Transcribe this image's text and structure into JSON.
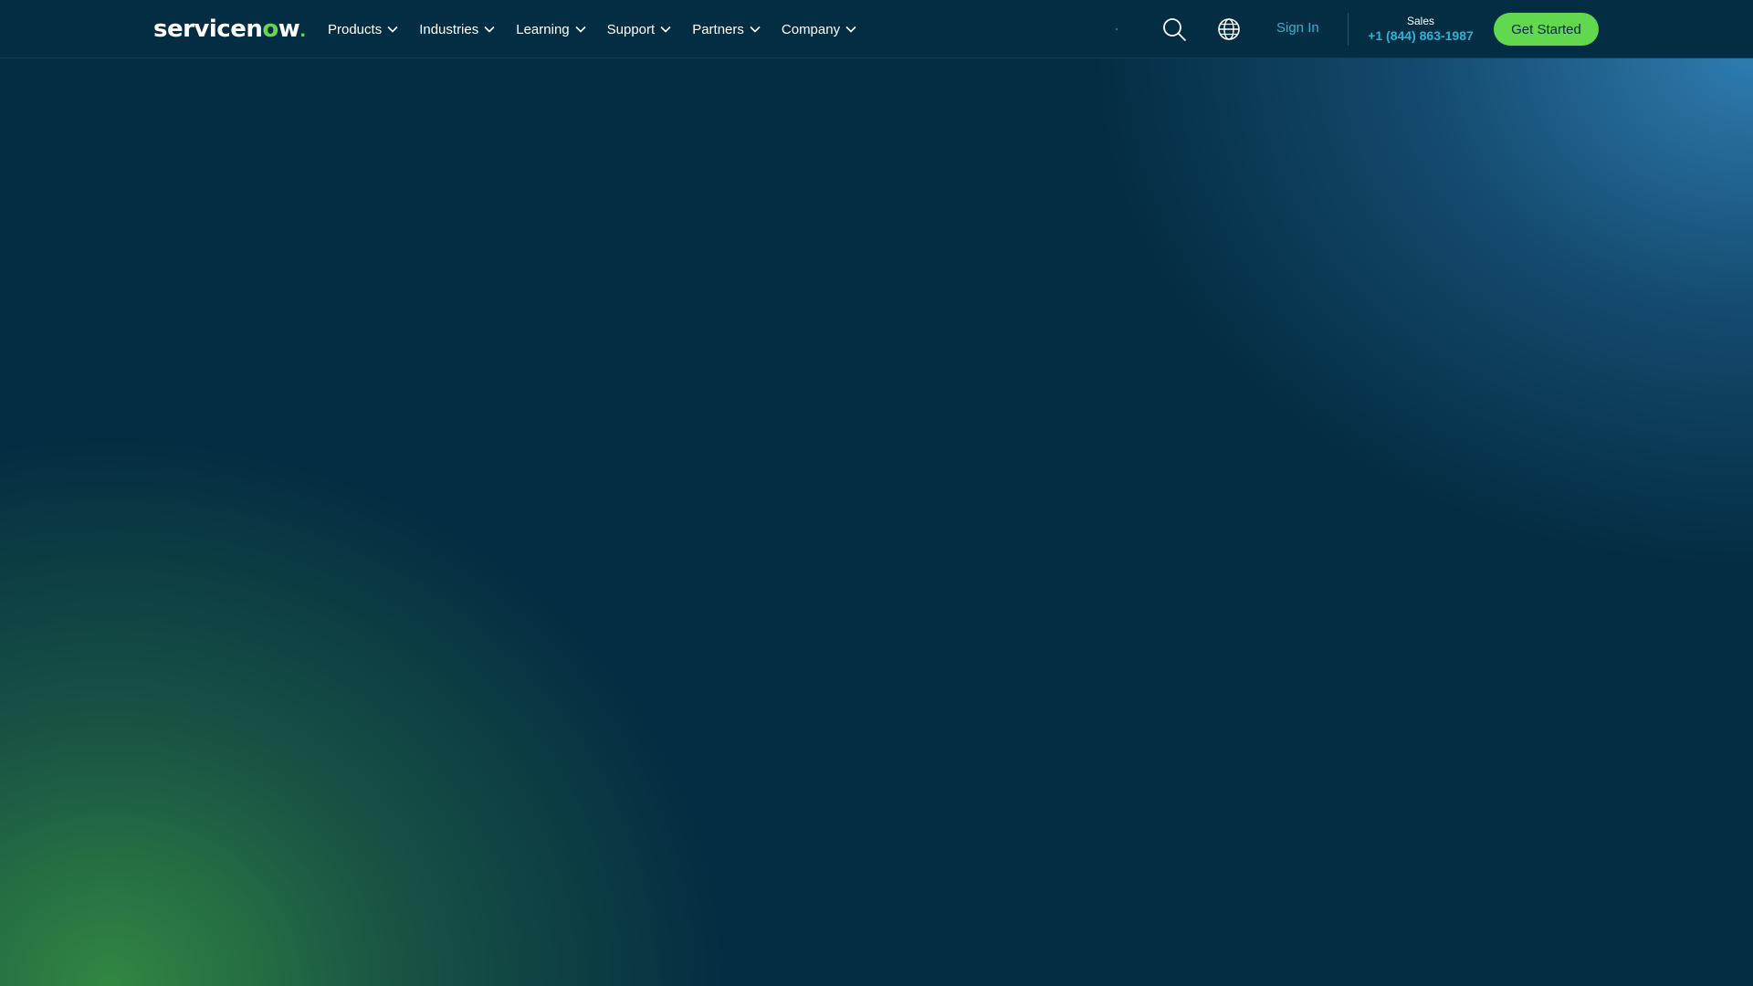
{
  "brand": {
    "logo_text_prefix": "servicen",
    "logo_text_o": "o",
    "logo_text_suffix": "w",
    "accent_color": "#62d84e",
    "background_color": "#032d42"
  },
  "nav": {
    "items": [
      {
        "label": "Products"
      },
      {
        "label": "Industries"
      },
      {
        "label": "Learning"
      },
      {
        "label": "Support"
      },
      {
        "label": "Partners"
      },
      {
        "label": "Company"
      }
    ]
  },
  "header_tools": {
    "search_icon": "search-icon",
    "globe_icon": "globe-icon",
    "sign_in_label": "Sign In",
    "sales_label": "Sales",
    "sales_phone": "+1 (844) 863-1987",
    "cta_label": "Get Started"
  }
}
